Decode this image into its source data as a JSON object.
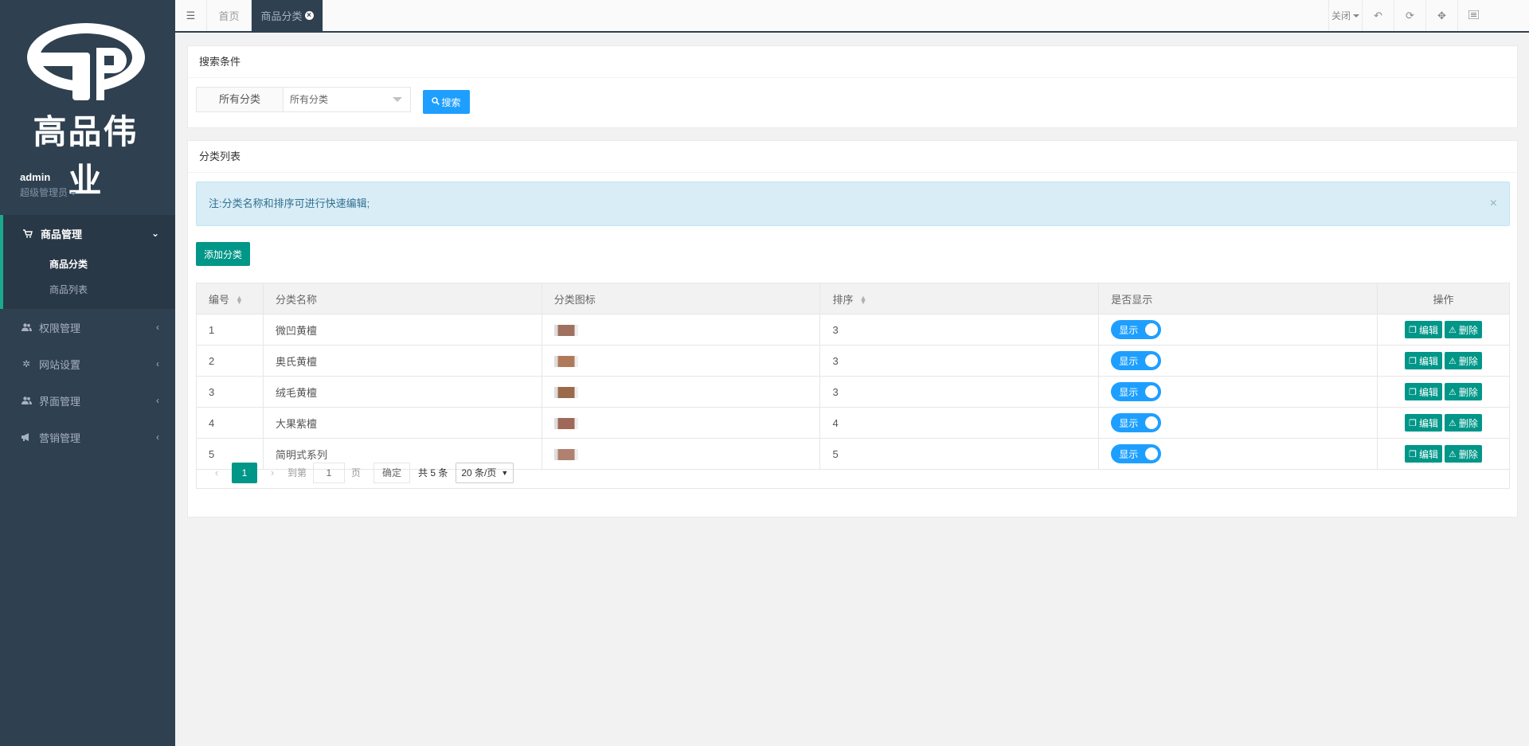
{
  "brand": {
    "name": "高品伟业"
  },
  "user": {
    "name": "admin",
    "role": "超级管理员"
  },
  "nav": [
    {
      "label": "商品管理",
      "icon": "cart-icon",
      "expanded": true,
      "children": [
        {
          "label": "商品分类",
          "active": true
        },
        {
          "label": "商品列表",
          "active": false
        }
      ]
    },
    {
      "label": "权限管理",
      "icon": "users-icon"
    },
    {
      "label": "网站设置",
      "icon": "gear-icon"
    },
    {
      "label": "界面管理",
      "icon": "users-icon"
    },
    {
      "label": "营销管理",
      "icon": "bullhorn-icon"
    }
  ],
  "tabs": [
    {
      "label": "首页"
    },
    {
      "label": "商品分类",
      "active": true
    }
  ],
  "topbar_right": {
    "close_label": "关闭"
  },
  "search": {
    "title": "搜索条件",
    "label": "所有分类",
    "select_value": "所有分类",
    "button": "搜索"
  },
  "list": {
    "title": "分类列表",
    "notice": "注:分类名称和排序可进行快速编辑;",
    "add_button": "添加分类",
    "columns": [
      "编号",
      "分类名称",
      "分类图标",
      "排序",
      "是否显示",
      "操作"
    ],
    "rows": [
      {
        "id": "1",
        "name": "微凹黄檀",
        "sort": "3",
        "show": "显示",
        "thumb_color": "#a07060"
      },
      {
        "id": "2",
        "name": "奥氏黄檀",
        "sort": "3",
        "show": "显示",
        "thumb_color": "#b07a5a"
      },
      {
        "id": "3",
        "name": "绒毛黄檀",
        "sort": "3",
        "show": "显示",
        "thumb_color": "#9a6a4a"
      },
      {
        "id": "4",
        "name": "大果紫檀",
        "sort": "4",
        "show": "显示",
        "thumb_color": "#a06858"
      },
      {
        "id": "5",
        "name": "简明式系列",
        "sort": "5",
        "show": "显示",
        "thumb_color": "#b08070"
      }
    ],
    "edit_label": "编辑",
    "delete_label": "删除"
  },
  "pager": {
    "current": "1",
    "goto": "到第",
    "input": "1",
    "page_unit": "页",
    "ok": "确定",
    "total": "共 5 条",
    "page_size": "20 条/页"
  },
  "colors": {
    "sidebar": "#2f4050",
    "teal": "#009688",
    "blue": "#1e9fff"
  }
}
